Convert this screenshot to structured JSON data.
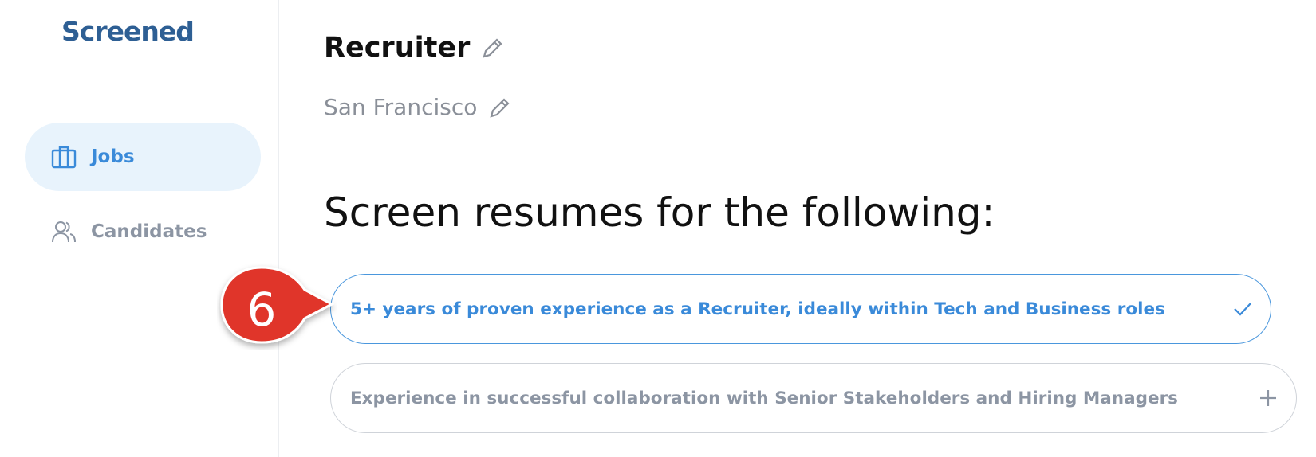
{
  "app": {
    "logo": "Screened"
  },
  "sidebar": {
    "items": [
      {
        "label": "Jobs",
        "icon": "briefcase-icon",
        "active": true
      },
      {
        "label": "Candidates",
        "icon": "users-icon",
        "active": false
      }
    ]
  },
  "job": {
    "title": "Recruiter",
    "location": "San Francisco"
  },
  "screen": {
    "heading": "Screen resumes for the following:",
    "criteria": [
      {
        "text": "5+ years of proven experience as a Recruiter, ideally within Tech and Business roles",
        "selected": true,
        "icon": "check-icon"
      },
      {
        "text": "Experience in successful collaboration with Senior Stakeholders and Hiring Managers",
        "selected": false,
        "icon": "plus-icon"
      }
    ]
  },
  "annotation": {
    "step_number": "6"
  },
  "colors": {
    "brand": "#2e5f94",
    "accent": "#3a8ad9",
    "active_bg": "#e8f3fc",
    "muted": "#8c95a3",
    "callout": "#e0362a"
  }
}
